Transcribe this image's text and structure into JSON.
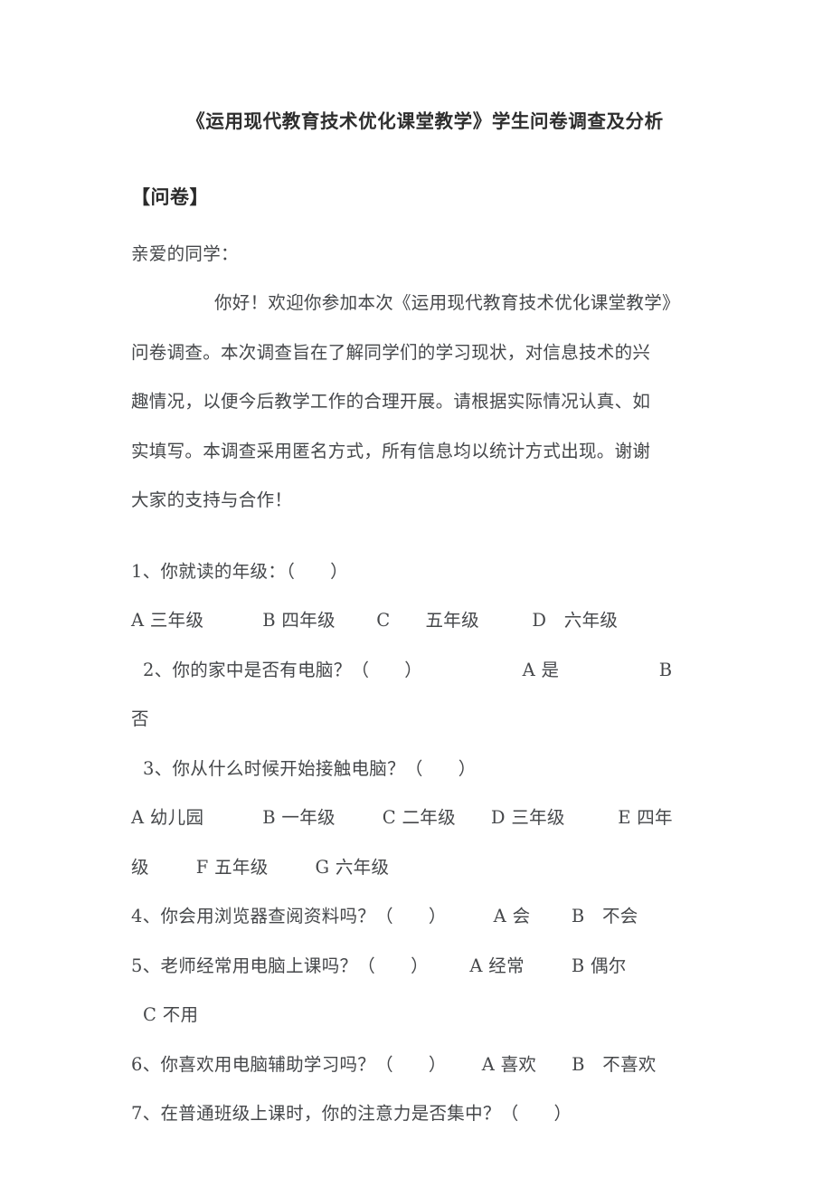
{
  "document": {
    "title": "《运用现代教育技术优化课堂教学》学生问卷调查及分析",
    "section_heading": "【问卷】",
    "salutation": "亲爱的同学：",
    "intro_paragraph": {
      "line_1": "你好！欢迎你参加本次《运用现代教育技术优化课堂教学》",
      "line_2": "问卷调查。本次调查旨在了解同学们的学习现状，对信息技术的兴",
      "line_3": "趣情况，以便今后教学工作的合理开展。请根据实际情况认真、如",
      "line_4": "实填写。本调查采用匿名方式，所有信息均以统计方式出现。谢谢",
      "line_5": "大家的支持与合作！"
    },
    "questions": [
      {
        "id": "q1",
        "stem": "1、你就读的年级：（      ）",
        "option_lines": [
          "A 三年级          B 四年级       C      五年级         D   六年级"
        ]
      },
      {
        "id": "q2",
        "stem": "  2、你的家中是否有电脑？（      ）                 A 是                 B",
        "option_lines": [
          "否"
        ]
      },
      {
        "id": "q3",
        "stem": "  3、你从什么时候开始接触电脑？（      ）",
        "option_lines": [
          "A 幼儿园          B 一年级        C 二年级      D 三年级         E 四年",
          "级        F 五年级        G 六年级"
        ]
      },
      {
        "id": "q4",
        "stem": "4、你会用浏览器查阅资料吗？（      ）        A 会       B   不会",
        "option_lines": []
      },
      {
        "id": "q5",
        "stem": "5、老师经常用电脑上课吗？（      ）       A 经常        B 偶尔",
        "option_lines": [
          "  C 不用"
        ]
      },
      {
        "id": "q6",
        "stem": "6、你喜欢用电脑辅助学习吗？（      ）      A 喜欢      B   不喜欢",
        "option_lines": []
      },
      {
        "id": "q7",
        "stem": "7、在普通班级上课时，你的注意力是否集中？（      ）",
        "option_lines": []
      }
    ]
  }
}
